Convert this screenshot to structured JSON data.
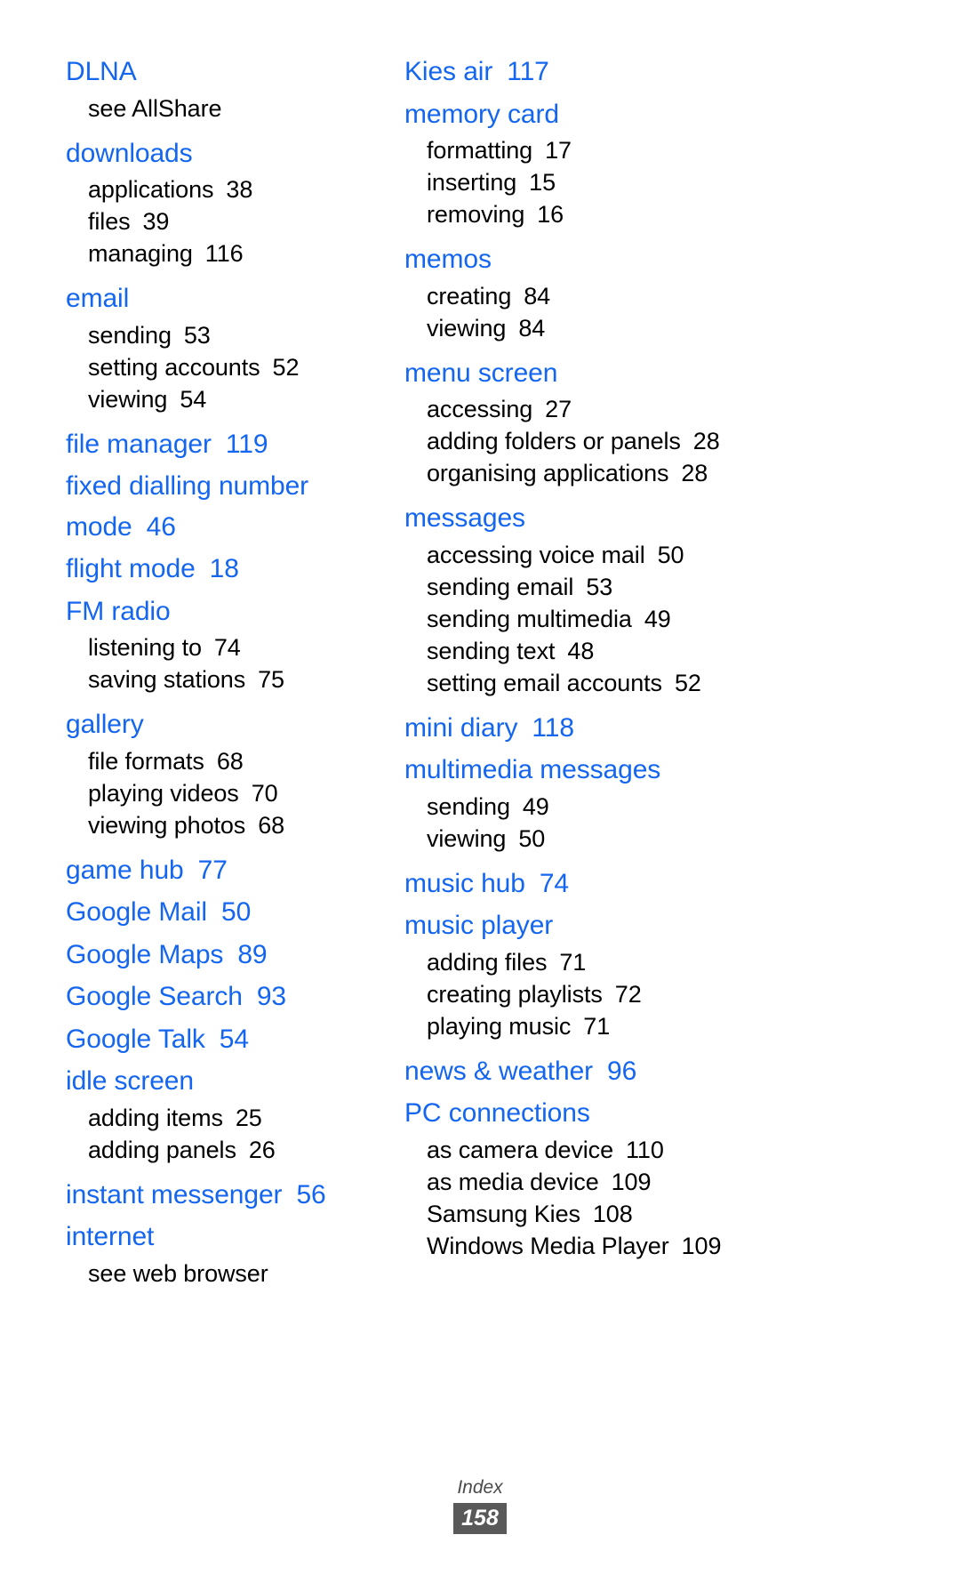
{
  "footer": {
    "label": "Index",
    "page_number": "158",
    "badge_color": "#595959",
    "badge_text_color": "#ffffff"
  },
  "accent_color": "#1466f0",
  "text_color": "#000000",
  "columns": [
    {
      "name": "left",
      "entries": [
        {
          "term": "DLNA",
          "page": "",
          "subs": [
            {
              "term": "see AllShare",
              "page": ""
            }
          ]
        },
        {
          "term": "downloads",
          "page": "",
          "subs": [
            {
              "term": "applications",
              "page": "38"
            },
            {
              "term": "files",
              "page": "39"
            },
            {
              "term": "managing",
              "page": "116"
            }
          ]
        },
        {
          "term": "email",
          "page": "",
          "subs": [
            {
              "term": "sending",
              "page": "53"
            },
            {
              "term": "setting accounts",
              "page": "52"
            },
            {
              "term": "viewing",
              "page": "54"
            }
          ]
        },
        {
          "term": "file manager",
          "page": "119",
          "subs": []
        },
        {
          "term": "fixed dialling number mode",
          "page": "46",
          "subs": []
        },
        {
          "term": "flight mode",
          "page": "18",
          "subs": []
        },
        {
          "term": "FM radio",
          "page": "",
          "subs": [
            {
              "term": "listening to",
              "page": "74"
            },
            {
              "term": "saving stations",
              "page": "75"
            }
          ]
        },
        {
          "term": "gallery",
          "page": "",
          "subs": [
            {
              "term": "file formats",
              "page": "68"
            },
            {
              "term": "playing videos",
              "page": "70"
            },
            {
              "term": "viewing photos",
              "page": "68"
            }
          ]
        },
        {
          "term": "game hub",
          "page": "77",
          "subs": []
        },
        {
          "term": "Google Mail",
          "page": "50",
          "subs": []
        },
        {
          "term": "Google Maps",
          "page": "89",
          "subs": []
        },
        {
          "term": "Google Search",
          "page": "93",
          "subs": []
        },
        {
          "term": "Google Talk",
          "page": "54",
          "subs": []
        },
        {
          "term": "idle screen",
          "page": "",
          "subs": [
            {
              "term": "adding items",
              "page": "25"
            },
            {
              "term": "adding panels",
              "page": "26"
            }
          ]
        },
        {
          "term": "instant messenger",
          "page": "56",
          "subs": []
        },
        {
          "term": "internet",
          "page": "",
          "subs": [
            {
              "term": "see web browser",
              "page": ""
            }
          ]
        }
      ]
    },
    {
      "name": "right",
      "entries": [
        {
          "term": "Kies air",
          "page": "117",
          "subs": []
        },
        {
          "term": "memory card",
          "page": "",
          "subs": [
            {
              "term": "formatting",
              "page": "17"
            },
            {
              "term": "inserting",
              "page": "15"
            },
            {
              "term": "removing",
              "page": "16"
            }
          ]
        },
        {
          "term": "memos",
          "page": "",
          "subs": [
            {
              "term": "creating",
              "page": "84"
            },
            {
              "term": "viewing",
              "page": "84"
            }
          ]
        },
        {
          "term": "menu screen",
          "page": "",
          "subs": [
            {
              "term": "accessing",
              "page": "27"
            },
            {
              "term": "adding folders or panels",
              "page": "28"
            },
            {
              "term": "organising applications",
              "page": "28"
            }
          ]
        },
        {
          "term": "messages",
          "page": "",
          "subs": [
            {
              "term": "accessing voice mail",
              "page": "50"
            },
            {
              "term": "sending email",
              "page": "53"
            },
            {
              "term": "sending multimedia",
              "page": "49"
            },
            {
              "term": "sending text",
              "page": "48"
            },
            {
              "term": "setting email accounts",
              "page": "52"
            }
          ]
        },
        {
          "term": "mini diary",
          "page": "118",
          "subs": []
        },
        {
          "term": "multimedia messages",
          "page": "",
          "subs": [
            {
              "term": "sending",
              "page": "49"
            },
            {
              "term": "viewing",
              "page": "50"
            }
          ]
        },
        {
          "term": "music hub",
          "page": "74",
          "subs": []
        },
        {
          "term": "music player",
          "page": "",
          "subs": [
            {
              "term": "adding files",
              "page": "71"
            },
            {
              "term": "creating playlists",
              "page": "72"
            },
            {
              "term": "playing music",
              "page": "71"
            }
          ]
        },
        {
          "term": "news & weather",
          "page": "96",
          "subs": []
        },
        {
          "term": "PC connections",
          "page": "",
          "subs": [
            {
              "term": "as camera device",
              "page": "110"
            },
            {
              "term": "as media device",
              "page": "109"
            },
            {
              "term": "Samsung Kies",
              "page": "108"
            },
            {
              "term": "Windows Media Player",
              "page": "109"
            }
          ]
        }
      ]
    }
  ]
}
